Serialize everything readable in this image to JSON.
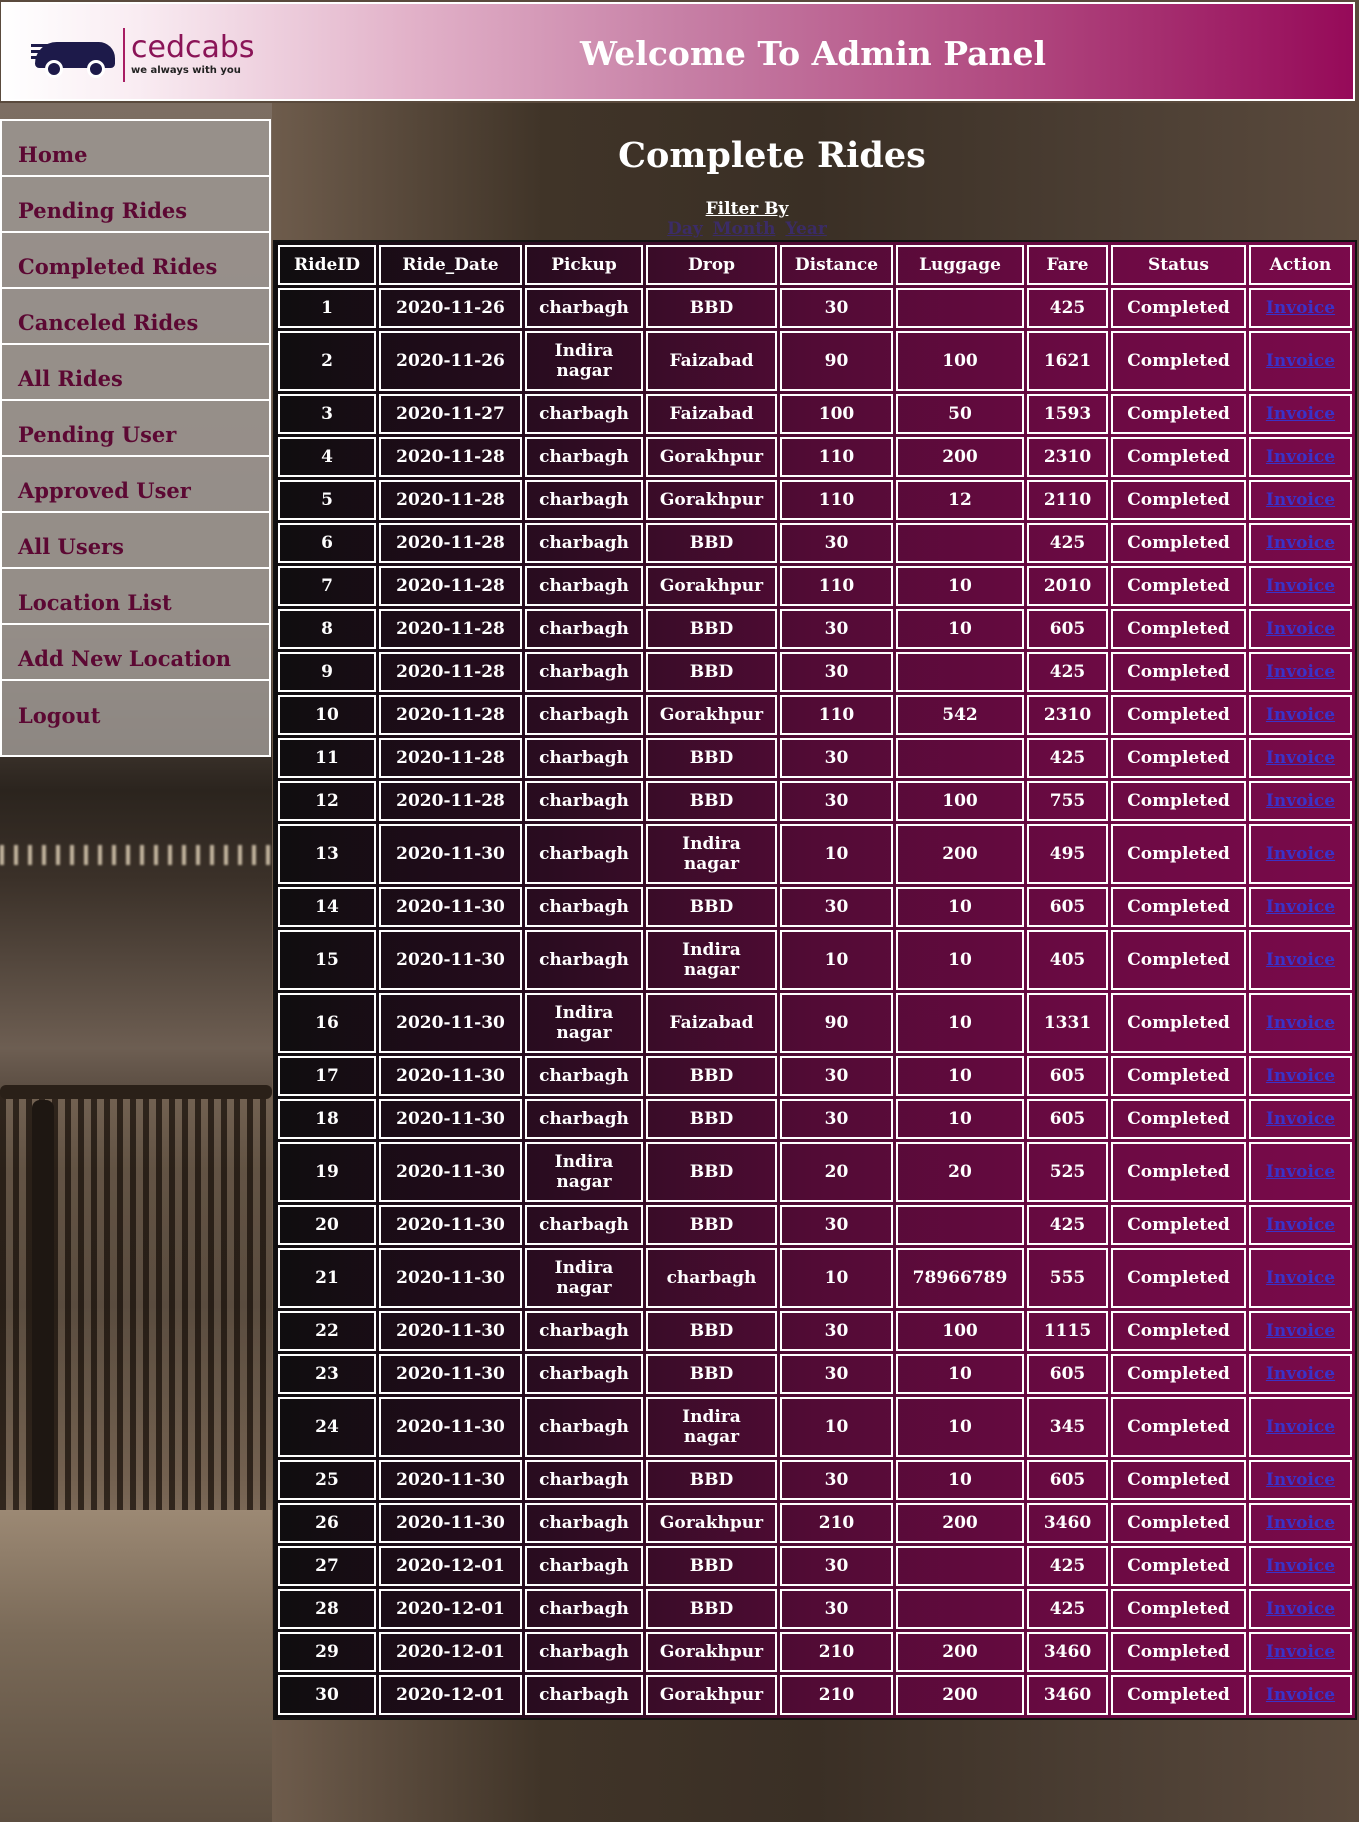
{
  "header": {
    "logo_name": "cedcabs",
    "logo_tagline": "we always with you",
    "title": "Welcome To Admin Panel"
  },
  "sidebar": {
    "items": [
      {
        "label": "Home"
      },
      {
        "label": "Pending Rides"
      },
      {
        "label": "Completed Rides"
      },
      {
        "label": "Canceled Rides"
      },
      {
        "label": "All Rides"
      },
      {
        "label": "Pending User"
      },
      {
        "label": "Approved User"
      },
      {
        "label": "All Users"
      },
      {
        "label": "Location List"
      },
      {
        "label": "Add New Location"
      },
      {
        "label": "Logout"
      }
    ]
  },
  "main": {
    "title": "Complete Rides",
    "filter_label": "Filter By",
    "filter_options": [
      "Day",
      "Month",
      "Year"
    ]
  },
  "table": {
    "columns": [
      "RideID",
      "Ride_Date",
      "Pickup",
      "Drop",
      "Distance",
      "Luggage",
      "Fare",
      "Status",
      "Action"
    ],
    "action_label": "Invoice",
    "rows": [
      {
        "id": "1",
        "date": "2020-11-26",
        "pickup": "charbagh",
        "drop": "BBD",
        "distance": "30",
        "luggage": "",
        "fare": "425",
        "status": "Completed"
      },
      {
        "id": "2",
        "date": "2020-11-26",
        "pickup": "Indira nagar",
        "drop": "Faizabad",
        "distance": "90",
        "luggage": "100",
        "fare": "1621",
        "status": "Completed"
      },
      {
        "id": "3",
        "date": "2020-11-27",
        "pickup": "charbagh",
        "drop": "Faizabad",
        "distance": "100",
        "luggage": "50",
        "fare": "1593",
        "status": "Completed"
      },
      {
        "id": "4",
        "date": "2020-11-28",
        "pickup": "charbagh",
        "drop": "Gorakhpur",
        "distance": "110",
        "luggage": "200",
        "fare": "2310",
        "status": "Completed"
      },
      {
        "id": "5",
        "date": "2020-11-28",
        "pickup": "charbagh",
        "drop": "Gorakhpur",
        "distance": "110",
        "luggage": "12",
        "fare": "2110",
        "status": "Completed"
      },
      {
        "id": "6",
        "date": "2020-11-28",
        "pickup": "charbagh",
        "drop": "BBD",
        "distance": "30",
        "luggage": "",
        "fare": "425",
        "status": "Completed"
      },
      {
        "id": "7",
        "date": "2020-11-28",
        "pickup": "charbagh",
        "drop": "Gorakhpur",
        "distance": "110",
        "luggage": "10",
        "fare": "2010",
        "status": "Completed"
      },
      {
        "id": "8",
        "date": "2020-11-28",
        "pickup": "charbagh",
        "drop": "BBD",
        "distance": "30",
        "luggage": "10",
        "fare": "605",
        "status": "Completed"
      },
      {
        "id": "9",
        "date": "2020-11-28",
        "pickup": "charbagh",
        "drop": "BBD",
        "distance": "30",
        "luggage": "",
        "fare": "425",
        "status": "Completed"
      },
      {
        "id": "10",
        "date": "2020-11-28",
        "pickup": "charbagh",
        "drop": "Gorakhpur",
        "distance": "110",
        "luggage": "542",
        "fare": "2310",
        "status": "Completed"
      },
      {
        "id": "11",
        "date": "2020-11-28",
        "pickup": "charbagh",
        "drop": "BBD",
        "distance": "30",
        "luggage": "",
        "fare": "425",
        "status": "Completed"
      },
      {
        "id": "12",
        "date": "2020-11-28",
        "pickup": "charbagh",
        "drop": "BBD",
        "distance": "30",
        "luggage": "100",
        "fare": "755",
        "status": "Completed"
      },
      {
        "id": "13",
        "date": "2020-11-30",
        "pickup": "charbagh",
        "drop": "Indira nagar",
        "distance": "10",
        "luggage": "200",
        "fare": "495",
        "status": "Completed"
      },
      {
        "id": "14",
        "date": "2020-11-30",
        "pickup": "charbagh",
        "drop": "BBD",
        "distance": "30",
        "luggage": "10",
        "fare": "605",
        "status": "Completed"
      },
      {
        "id": "15",
        "date": "2020-11-30",
        "pickup": "charbagh",
        "drop": "Indira nagar",
        "distance": "10",
        "luggage": "10",
        "fare": "405",
        "status": "Completed"
      },
      {
        "id": "16",
        "date": "2020-11-30",
        "pickup": "Indira nagar",
        "drop": "Faizabad",
        "distance": "90",
        "luggage": "10",
        "fare": "1331",
        "status": "Completed"
      },
      {
        "id": "17",
        "date": "2020-11-30",
        "pickup": "charbagh",
        "drop": "BBD",
        "distance": "30",
        "luggage": "10",
        "fare": "605",
        "status": "Completed"
      },
      {
        "id": "18",
        "date": "2020-11-30",
        "pickup": "charbagh",
        "drop": "BBD",
        "distance": "30",
        "luggage": "10",
        "fare": "605",
        "status": "Completed"
      },
      {
        "id": "19",
        "date": "2020-11-30",
        "pickup": "Indira nagar",
        "drop": "BBD",
        "distance": "20",
        "luggage": "20",
        "fare": "525",
        "status": "Completed"
      },
      {
        "id": "20",
        "date": "2020-11-30",
        "pickup": "charbagh",
        "drop": "BBD",
        "distance": "30",
        "luggage": "",
        "fare": "425",
        "status": "Completed"
      },
      {
        "id": "21",
        "date": "2020-11-30",
        "pickup": "Indira nagar",
        "drop": "charbagh",
        "distance": "10",
        "luggage": "78966789",
        "fare": "555",
        "status": "Completed"
      },
      {
        "id": "22",
        "date": "2020-11-30",
        "pickup": "charbagh",
        "drop": "BBD",
        "distance": "30",
        "luggage": "100",
        "fare": "1115",
        "status": "Completed"
      },
      {
        "id": "23",
        "date": "2020-11-30",
        "pickup": "charbagh",
        "drop": "BBD",
        "distance": "30",
        "luggage": "10",
        "fare": "605",
        "status": "Completed"
      },
      {
        "id": "24",
        "date": "2020-11-30",
        "pickup": "charbagh",
        "drop": "Indira nagar",
        "distance": "10",
        "luggage": "10",
        "fare": "345",
        "status": "Completed"
      },
      {
        "id": "25",
        "date": "2020-11-30",
        "pickup": "charbagh",
        "drop": "BBD",
        "distance": "30",
        "luggage": "10",
        "fare": "605",
        "status": "Completed"
      },
      {
        "id": "26",
        "date": "2020-11-30",
        "pickup": "charbagh",
        "drop": "Gorakhpur",
        "distance": "210",
        "luggage": "200",
        "fare": "3460",
        "status": "Completed"
      },
      {
        "id": "27",
        "date": "2020-12-01",
        "pickup": "charbagh",
        "drop": "BBD",
        "distance": "30",
        "luggage": "",
        "fare": "425",
        "status": "Completed"
      },
      {
        "id": "28",
        "date": "2020-12-01",
        "pickup": "charbagh",
        "drop": "BBD",
        "distance": "30",
        "luggage": "",
        "fare": "425",
        "status": "Completed"
      },
      {
        "id": "29",
        "date": "2020-12-01",
        "pickup": "charbagh",
        "drop": "Gorakhpur",
        "distance": "210",
        "luggage": "200",
        "fare": "3460",
        "status": "Completed"
      },
      {
        "id": "30",
        "date": "2020-12-01",
        "pickup": "charbagh",
        "drop": "Gorakhpur",
        "distance": "210",
        "luggage": "200",
        "fare": "3460",
        "status": "Completed"
      }
    ]
  }
}
